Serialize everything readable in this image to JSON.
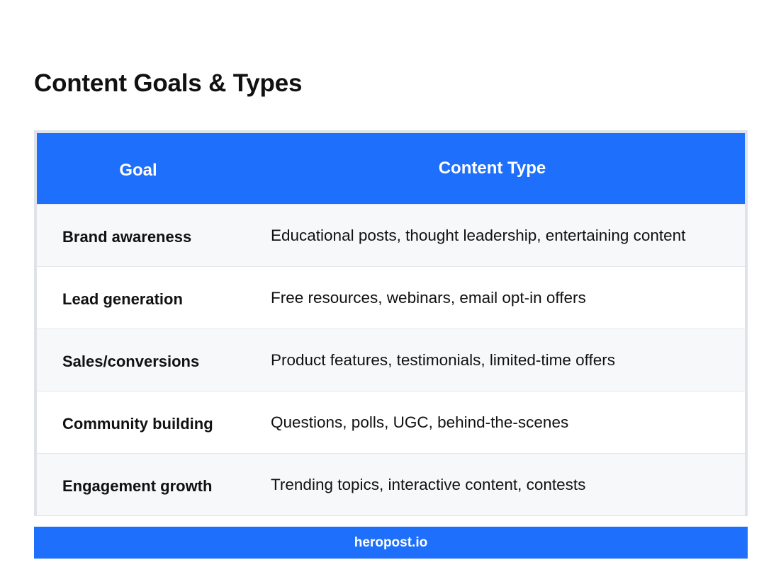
{
  "page": {
    "title": "Content Goals & Types"
  },
  "table": {
    "headers": {
      "goal": "Goal",
      "content_type": "Content Type"
    },
    "rows": [
      {
        "goal": "Brand awareness",
        "content_type": "Educational posts, thought leadership, entertaining content"
      },
      {
        "goal": "Lead generation",
        "content_type": "Free resources, webinars, email opt-in offers"
      },
      {
        "goal": "Sales/conversions",
        "content_type": "Product features, testimonials, limited-time offers"
      },
      {
        "goal": "Community building",
        "content_type": "Questions, polls, UGC, behind-the-scenes"
      },
      {
        "goal": "Engagement growth",
        "content_type": "Trending topics, interactive content, contests"
      }
    ]
  },
  "footer": {
    "label": "heropost.io"
  },
  "colors": {
    "accent": "#1e6ffb",
    "row_shade": "#f7f8fa",
    "frame": "#dfe2e8"
  }
}
